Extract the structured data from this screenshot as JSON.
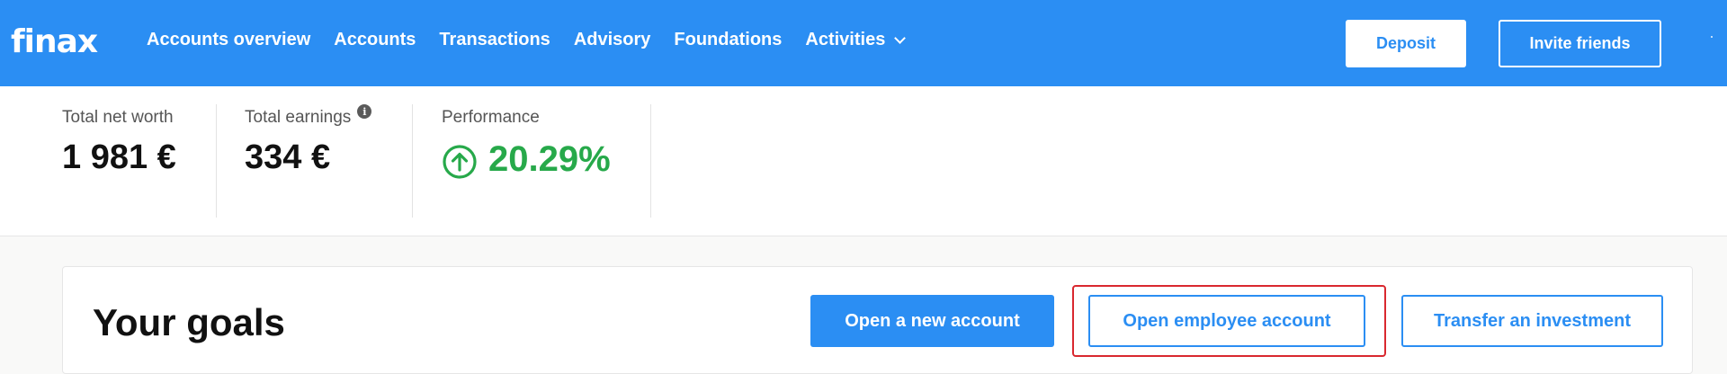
{
  "brand": {
    "logo_text": "finax",
    "primary_color": "#2b8ef3",
    "positive_color": "#27a94a"
  },
  "nav": {
    "items": [
      {
        "label": "Accounts overview"
      },
      {
        "label": "Accounts"
      },
      {
        "label": "Transactions"
      },
      {
        "label": "Advisory"
      },
      {
        "label": "Foundations"
      },
      {
        "label": "Activities",
        "has_dropdown": true
      }
    ],
    "deposit_label": "Deposit",
    "invite_label": "Invite friends"
  },
  "stats": {
    "net_worth": {
      "label": "Total net worth",
      "value": "1 981 €"
    },
    "earnings": {
      "label": "Total earnings",
      "value": "334 €",
      "info_icon": "info-icon"
    },
    "performance": {
      "label": "Performance",
      "value": "20.29%",
      "trend_icon": "arrow-up-circle-icon"
    }
  },
  "goals": {
    "title": "Your goals",
    "open_new_account_label": "Open a new account",
    "open_employee_account_label": "Open employee account",
    "transfer_investment_label": "Transfer an investment",
    "highlight_color": "#d9282f"
  }
}
